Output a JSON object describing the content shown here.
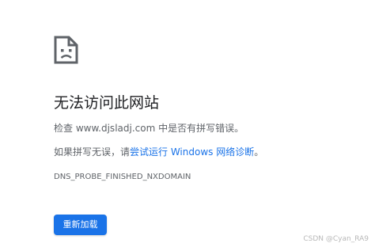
{
  "error": {
    "icon": "sad-document-icon",
    "title": "无法访问此网站",
    "check_prefix": "检查 ",
    "domain": "www.djsladj.com",
    "check_suffix": " 中是否有拼写错误。",
    "spelling_prefix": "如果拼写无误，请",
    "diagnostics_link": "尝试运行 Windows 网络诊断",
    "spelling_suffix": "。",
    "code": "DNS_PROBE_FINISHED_NXDOMAIN"
  },
  "actions": {
    "reload_label": "重新加载"
  },
  "colors": {
    "accent": "#1a73e8",
    "title": "#202124",
    "text": "#5f6368"
  },
  "watermark": "CSDN @Cyan_RA9"
}
